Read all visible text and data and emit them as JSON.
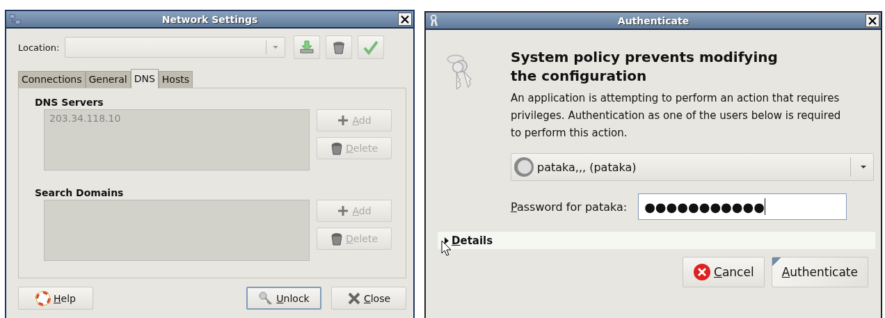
{
  "network_window": {
    "title": "Network Settings",
    "location": {
      "label": "Location:"
    },
    "tabs": [
      {
        "label": "Connections",
        "selected": false
      },
      {
        "label": "General",
        "selected": false
      },
      {
        "label": "DNS",
        "selected": true
      },
      {
        "label": "Hosts",
        "selected": false
      }
    ],
    "sections": [
      {
        "heading": "DNS Servers",
        "entries": [
          "203.34.118.10"
        ],
        "disabled": true,
        "buttons": [
          {
            "kind": "add",
            "label": "Add",
            "disabled": true
          },
          {
            "kind": "delete",
            "label": "Delete",
            "disabled": true
          }
        ]
      },
      {
        "heading": "Search Domains",
        "disabled": true,
        "buttons": [
          {
            "kind": "add",
            "label": "Add",
            "disabled": true
          },
          {
            "kind": "delete",
            "label": "Delete",
            "disabled": true
          }
        ]
      }
    ],
    "buttons": [
      {
        "kind": "help",
        "label": "Help",
        "focused": false
      },
      {
        "kind": "unlock",
        "label": "Unlock",
        "focused": true
      },
      {
        "kind": "close",
        "label": "Close",
        "focused": false
      }
    ]
  },
  "auth_window": {
    "title": "Authenticate",
    "heading": "System policy prevents modifying the configuration",
    "message": "An application is attempting to perform an action that requires privileges. Authentication as one of the users below is required to perform this action.",
    "user": "pataka,,, (pataka)",
    "password": {
      "label": "Password for pataka:",
      "value": "●●●●●●●●●●●"
    },
    "details": {
      "label": "Details",
      "expanded": false
    },
    "buttons": [
      {
        "kind": "cancel",
        "label": "Cancel",
        "focused": false
      },
      {
        "kind": "authenticate",
        "label": "Authenticate",
        "focused": true
      }
    ]
  }
}
